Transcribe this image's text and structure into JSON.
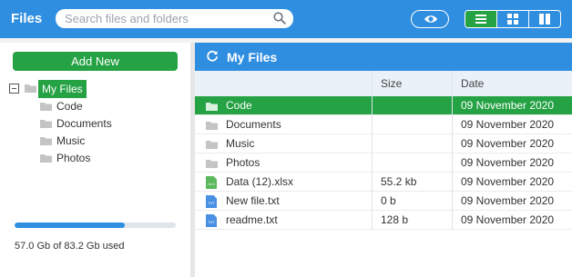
{
  "topbar": {
    "title": "Files",
    "search_placeholder": "Search files and folders",
    "icons": {
      "search": "search-icon",
      "preview": "eye-icon",
      "list": "list-view-icon",
      "grid": "grid-view-icon",
      "columns": "columns-view-icon"
    }
  },
  "sidebar": {
    "add_label": "Add New",
    "tree": {
      "root": "My Files",
      "children": [
        "Code",
        "Documents",
        "Music",
        "Photos"
      ]
    },
    "storage": {
      "used_fraction": 0.685,
      "text": "57.0 Gb of 83.2 Gb used"
    }
  },
  "main": {
    "title": "My Files",
    "columns": {
      "name": "",
      "size": "Size",
      "date": "Date"
    },
    "rows": [
      {
        "name": "Code",
        "size": "",
        "date": "09 November 2020",
        "type": "folder",
        "selected": true
      },
      {
        "name": "Documents",
        "size": "",
        "date": "09 November 2020",
        "type": "folder"
      },
      {
        "name": "Music",
        "size": "",
        "date": "09 November 2020",
        "type": "folder"
      },
      {
        "name": "Photos",
        "size": "",
        "date": "09 November 2020",
        "type": "folder"
      },
      {
        "name": "Data (12).xlsx",
        "size": "55.2 kb",
        "date": "09 November 2020",
        "type": "xls"
      },
      {
        "name": "New file.txt",
        "size": "0 b",
        "date": "09 November 2020",
        "type": "txt"
      },
      {
        "name": "readme.txt",
        "size": "128 b",
        "date": "09 November 2020",
        "type": "txt"
      }
    ]
  },
  "colors": {
    "primary": "#2f8ee0",
    "accent": "#25a244",
    "folder": "#c4c4c4",
    "xls": "#5cb85c",
    "txt": "#4a90e2"
  },
  "file_badges": {
    "xls": "XLS",
    "txt": "TXT"
  }
}
